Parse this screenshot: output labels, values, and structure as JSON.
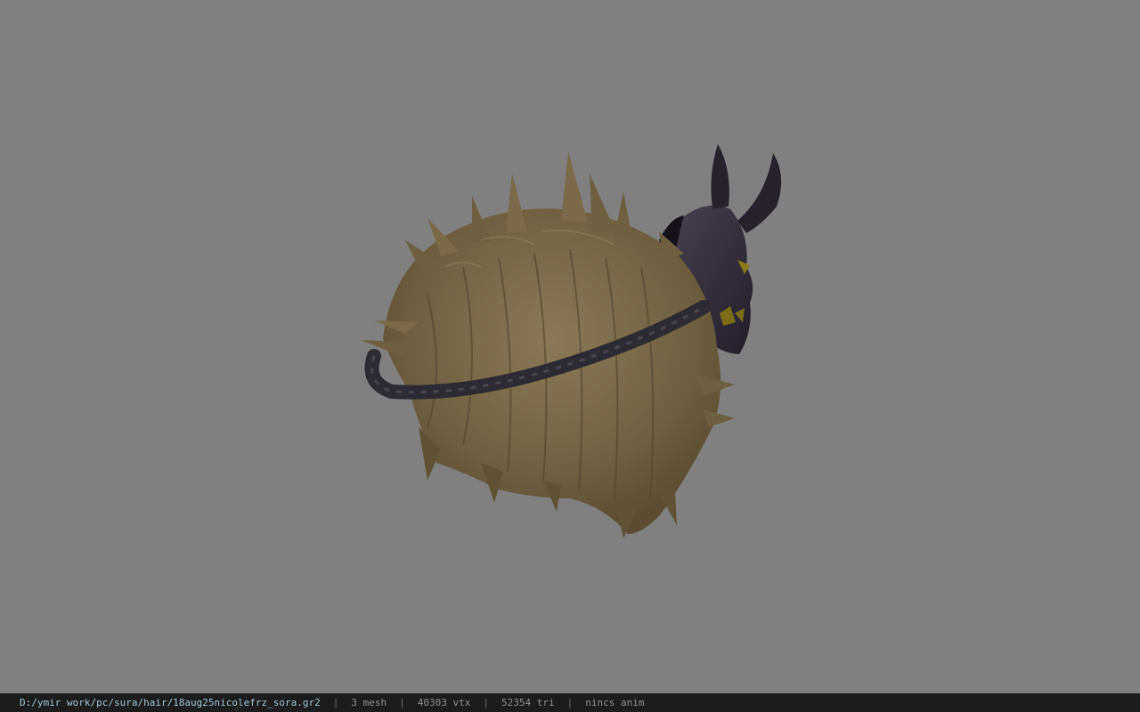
{
  "viewport": {
    "background": "#808080",
    "model_description_colors": {
      "hair": "#7a6a4a",
      "rope": "#2c2b33",
      "mask": "#3a3340",
      "mask_accent": "#8a7a1e"
    }
  },
  "statusbar": {
    "path": "D:/ymir work/pc/sura/hair/18aug25nicolefrz_sora.gr2",
    "sep": "|",
    "mesh": "3 mesh",
    "vtx": "40303 vtx",
    "tri": "52354 tri",
    "anim": "nincs anim"
  }
}
